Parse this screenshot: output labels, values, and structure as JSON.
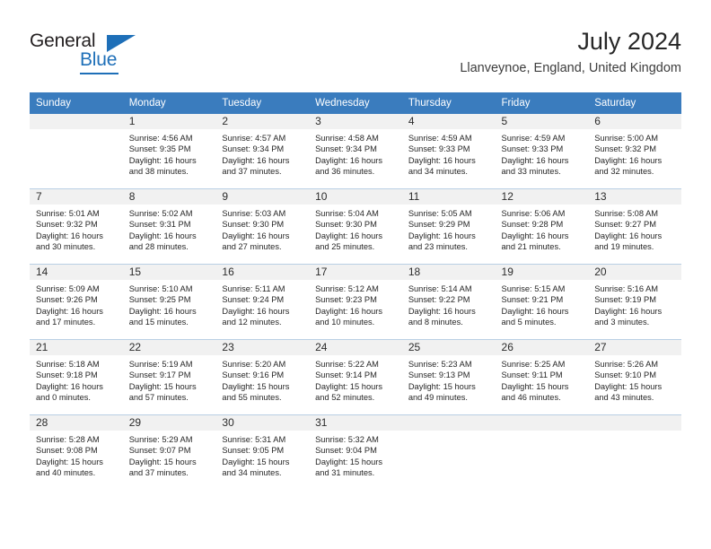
{
  "brand": {
    "name_part1": "General",
    "name_part2": "Blue",
    "accent_color": "#1e6fb8"
  },
  "header": {
    "title": "July 2024",
    "subtitle": "Llanveynoe, England, United Kingdom",
    "header_bg_color": "#3a7cbe",
    "daynum_band_color": "#f1f1f1"
  },
  "weekday_headers": [
    "Sunday",
    "Monday",
    "Tuesday",
    "Wednesday",
    "Thursday",
    "Friday",
    "Saturday"
  ],
  "weeks": [
    [
      {
        "day": "",
        "sunrise": "",
        "sunset": "",
        "daylight_line1": "",
        "daylight_line2": ""
      },
      {
        "day": "1",
        "sunrise": "Sunrise: 4:56 AM",
        "sunset": "Sunset: 9:35 PM",
        "daylight_line1": "Daylight: 16 hours",
        "daylight_line2": "and 38 minutes."
      },
      {
        "day": "2",
        "sunrise": "Sunrise: 4:57 AM",
        "sunset": "Sunset: 9:34 PM",
        "daylight_line1": "Daylight: 16 hours",
        "daylight_line2": "and 37 minutes."
      },
      {
        "day": "3",
        "sunrise": "Sunrise: 4:58 AM",
        "sunset": "Sunset: 9:34 PM",
        "daylight_line1": "Daylight: 16 hours",
        "daylight_line2": "and 36 minutes."
      },
      {
        "day": "4",
        "sunrise": "Sunrise: 4:59 AM",
        "sunset": "Sunset: 9:33 PM",
        "daylight_line1": "Daylight: 16 hours",
        "daylight_line2": "and 34 minutes."
      },
      {
        "day": "5",
        "sunrise": "Sunrise: 4:59 AM",
        "sunset": "Sunset: 9:33 PM",
        "daylight_line1": "Daylight: 16 hours",
        "daylight_line2": "and 33 minutes."
      },
      {
        "day": "6",
        "sunrise": "Sunrise: 5:00 AM",
        "sunset": "Sunset: 9:32 PM",
        "daylight_line1": "Daylight: 16 hours",
        "daylight_line2": "and 32 minutes."
      }
    ],
    [
      {
        "day": "7",
        "sunrise": "Sunrise: 5:01 AM",
        "sunset": "Sunset: 9:32 PM",
        "daylight_line1": "Daylight: 16 hours",
        "daylight_line2": "and 30 minutes."
      },
      {
        "day": "8",
        "sunrise": "Sunrise: 5:02 AM",
        "sunset": "Sunset: 9:31 PM",
        "daylight_line1": "Daylight: 16 hours",
        "daylight_line2": "and 28 minutes."
      },
      {
        "day": "9",
        "sunrise": "Sunrise: 5:03 AM",
        "sunset": "Sunset: 9:30 PM",
        "daylight_line1": "Daylight: 16 hours",
        "daylight_line2": "and 27 minutes."
      },
      {
        "day": "10",
        "sunrise": "Sunrise: 5:04 AM",
        "sunset": "Sunset: 9:30 PM",
        "daylight_line1": "Daylight: 16 hours",
        "daylight_line2": "and 25 minutes."
      },
      {
        "day": "11",
        "sunrise": "Sunrise: 5:05 AM",
        "sunset": "Sunset: 9:29 PM",
        "daylight_line1": "Daylight: 16 hours",
        "daylight_line2": "and 23 minutes."
      },
      {
        "day": "12",
        "sunrise": "Sunrise: 5:06 AM",
        "sunset": "Sunset: 9:28 PM",
        "daylight_line1": "Daylight: 16 hours",
        "daylight_line2": "and 21 minutes."
      },
      {
        "day": "13",
        "sunrise": "Sunrise: 5:08 AM",
        "sunset": "Sunset: 9:27 PM",
        "daylight_line1": "Daylight: 16 hours",
        "daylight_line2": "and 19 minutes."
      }
    ],
    [
      {
        "day": "14",
        "sunrise": "Sunrise: 5:09 AM",
        "sunset": "Sunset: 9:26 PM",
        "daylight_line1": "Daylight: 16 hours",
        "daylight_line2": "and 17 minutes."
      },
      {
        "day": "15",
        "sunrise": "Sunrise: 5:10 AM",
        "sunset": "Sunset: 9:25 PM",
        "daylight_line1": "Daylight: 16 hours",
        "daylight_line2": "and 15 minutes."
      },
      {
        "day": "16",
        "sunrise": "Sunrise: 5:11 AM",
        "sunset": "Sunset: 9:24 PM",
        "daylight_line1": "Daylight: 16 hours",
        "daylight_line2": "and 12 minutes."
      },
      {
        "day": "17",
        "sunrise": "Sunrise: 5:12 AM",
        "sunset": "Sunset: 9:23 PM",
        "daylight_line1": "Daylight: 16 hours",
        "daylight_line2": "and 10 minutes."
      },
      {
        "day": "18",
        "sunrise": "Sunrise: 5:14 AM",
        "sunset": "Sunset: 9:22 PM",
        "daylight_line1": "Daylight: 16 hours",
        "daylight_line2": "and 8 minutes."
      },
      {
        "day": "19",
        "sunrise": "Sunrise: 5:15 AM",
        "sunset": "Sunset: 9:21 PM",
        "daylight_line1": "Daylight: 16 hours",
        "daylight_line2": "and 5 minutes."
      },
      {
        "day": "20",
        "sunrise": "Sunrise: 5:16 AM",
        "sunset": "Sunset: 9:19 PM",
        "daylight_line1": "Daylight: 16 hours",
        "daylight_line2": "and 3 minutes."
      }
    ],
    [
      {
        "day": "21",
        "sunrise": "Sunrise: 5:18 AM",
        "sunset": "Sunset: 9:18 PM",
        "daylight_line1": "Daylight: 16 hours",
        "daylight_line2": "and 0 minutes."
      },
      {
        "day": "22",
        "sunrise": "Sunrise: 5:19 AM",
        "sunset": "Sunset: 9:17 PM",
        "daylight_line1": "Daylight: 15 hours",
        "daylight_line2": "and 57 minutes."
      },
      {
        "day": "23",
        "sunrise": "Sunrise: 5:20 AM",
        "sunset": "Sunset: 9:16 PM",
        "daylight_line1": "Daylight: 15 hours",
        "daylight_line2": "and 55 minutes."
      },
      {
        "day": "24",
        "sunrise": "Sunrise: 5:22 AM",
        "sunset": "Sunset: 9:14 PM",
        "daylight_line1": "Daylight: 15 hours",
        "daylight_line2": "and 52 minutes."
      },
      {
        "day": "25",
        "sunrise": "Sunrise: 5:23 AM",
        "sunset": "Sunset: 9:13 PM",
        "daylight_line1": "Daylight: 15 hours",
        "daylight_line2": "and 49 minutes."
      },
      {
        "day": "26",
        "sunrise": "Sunrise: 5:25 AM",
        "sunset": "Sunset: 9:11 PM",
        "daylight_line1": "Daylight: 15 hours",
        "daylight_line2": "and 46 minutes."
      },
      {
        "day": "27",
        "sunrise": "Sunrise: 5:26 AM",
        "sunset": "Sunset: 9:10 PM",
        "daylight_line1": "Daylight: 15 hours",
        "daylight_line2": "and 43 minutes."
      }
    ],
    [
      {
        "day": "28",
        "sunrise": "Sunrise: 5:28 AM",
        "sunset": "Sunset: 9:08 PM",
        "daylight_line1": "Daylight: 15 hours",
        "daylight_line2": "and 40 minutes."
      },
      {
        "day": "29",
        "sunrise": "Sunrise: 5:29 AM",
        "sunset": "Sunset: 9:07 PM",
        "daylight_line1": "Daylight: 15 hours",
        "daylight_line2": "and 37 minutes."
      },
      {
        "day": "30",
        "sunrise": "Sunrise: 5:31 AM",
        "sunset": "Sunset: 9:05 PM",
        "daylight_line1": "Daylight: 15 hours",
        "daylight_line2": "and 34 minutes."
      },
      {
        "day": "31",
        "sunrise": "Sunrise: 5:32 AM",
        "sunset": "Sunset: 9:04 PM",
        "daylight_line1": "Daylight: 15 hours",
        "daylight_line2": "and 31 minutes."
      },
      {
        "day": "",
        "sunrise": "",
        "sunset": "",
        "daylight_line1": "",
        "daylight_line2": ""
      },
      {
        "day": "",
        "sunrise": "",
        "sunset": "",
        "daylight_line1": "",
        "daylight_line2": ""
      },
      {
        "day": "",
        "sunrise": "",
        "sunset": "",
        "daylight_line1": "",
        "daylight_line2": ""
      }
    ]
  ]
}
